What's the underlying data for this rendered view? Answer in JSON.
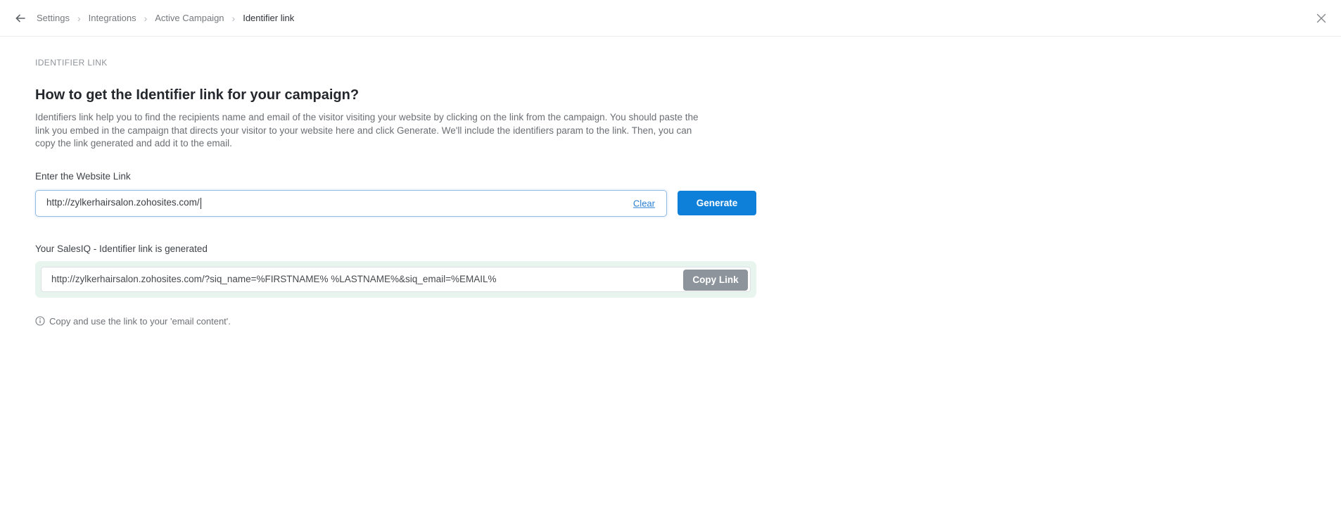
{
  "header": {
    "separator": "›",
    "breadcrumb": [
      {
        "label": "Settings"
      },
      {
        "label": "Integrations"
      },
      {
        "label": "Active Campaign"
      },
      {
        "label": "Identifier link"
      }
    ],
    "icons": {
      "back": "arrow-left-icon",
      "close": "close-icon"
    }
  },
  "main": {
    "section_label": "IDENTIFIER LINK",
    "title": "How to get the Identifier link for your campaign?",
    "description": "Identifiers link help you to find the recipients name and email of the visitor visiting your website by clicking on the link from the campaign. You should paste the link you embed in the campaign that directs your visitor to your website here and click Generate. We'll include the identifiers param to the link. Then, you can copy the link generated and add it to the email.",
    "website_link": {
      "label": "Enter the Website Link",
      "value": "http://zylkerhairsalon.zohosites.com/",
      "clear_label": "Clear",
      "generate_label": "Generate"
    },
    "generated": {
      "label": "Your SalesIQ - Identifier link is generated",
      "value": "http://zylkerhairsalon.zohosites.com/?siq_name=%FIRSTNAME% %LASTNAME%&siq_email=%EMAIL%",
      "copy_label": "Copy Link",
      "note": "Copy and use the link to your 'email content'.",
      "note_icon": "info-icon"
    }
  },
  "colors": {
    "accent_blue": "#0e80da",
    "link_blue": "#2a7fd0",
    "copy_gray": "#8d949b",
    "success_bg": "#e8f5ee",
    "input_focus_border": "#93bae0"
  }
}
